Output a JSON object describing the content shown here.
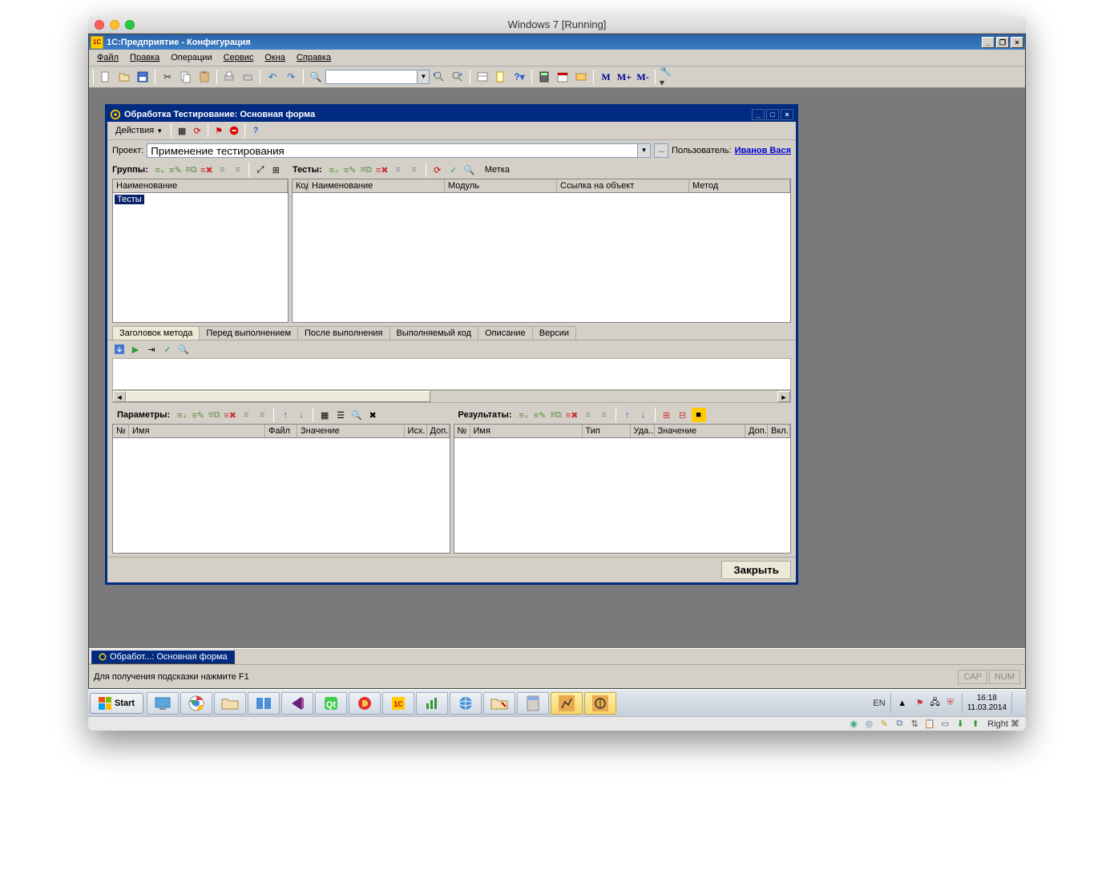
{
  "vm": {
    "title": "Windows 7 [Running]",
    "host_key": "Right ⌘"
  },
  "app": {
    "title": "1С:Предприятие - Конфигурация",
    "menu": [
      "Файл",
      "Правка",
      "Операции",
      "Сервис",
      "Окна",
      "Справка"
    ]
  },
  "toolbar": {
    "m_labels": [
      "M",
      "M+",
      "M-"
    ]
  },
  "child": {
    "title": "Обработка Тестирование: Основная форма",
    "actions_label": "Действия",
    "project_label": "Проект:",
    "project_value": "Применение тестирования",
    "user_label": "Пользователь:",
    "user_value": "Иванов Вася",
    "groups_label": "Группы:",
    "tests_label": "Тесты:",
    "mark_label": "Метка",
    "left_grid": {
      "header": "Наименование",
      "item": "Тесты"
    },
    "right_grid_cols": [
      "Код",
      "Наименование",
      "Модуль",
      "Ссылка на объект",
      "Метод"
    ],
    "tabs": [
      "Заголовок метода",
      "Перед выполнением",
      "После выполнения",
      "Выполняемый код",
      "Описание",
      "Версии"
    ],
    "params_label": "Параметры:",
    "results_label": "Результаты:",
    "params_cols": [
      "№",
      "Имя",
      "Файл",
      "Значение",
      "Исх.",
      "Доп."
    ],
    "results_cols": [
      "№",
      "Имя",
      "Тип",
      "Уда...",
      "Значение",
      "Доп.",
      "Вкл."
    ],
    "close_label": "Закрыть"
  },
  "mdi_task": "Обработ...: Основная форма",
  "statusbar": {
    "hint": "Для получения подсказки нажмите F1",
    "cap": "CAP",
    "num": "NUM"
  },
  "taskbar": {
    "start": "Start",
    "lang": "EN",
    "time": "16:18",
    "date": "11.03.2014"
  }
}
